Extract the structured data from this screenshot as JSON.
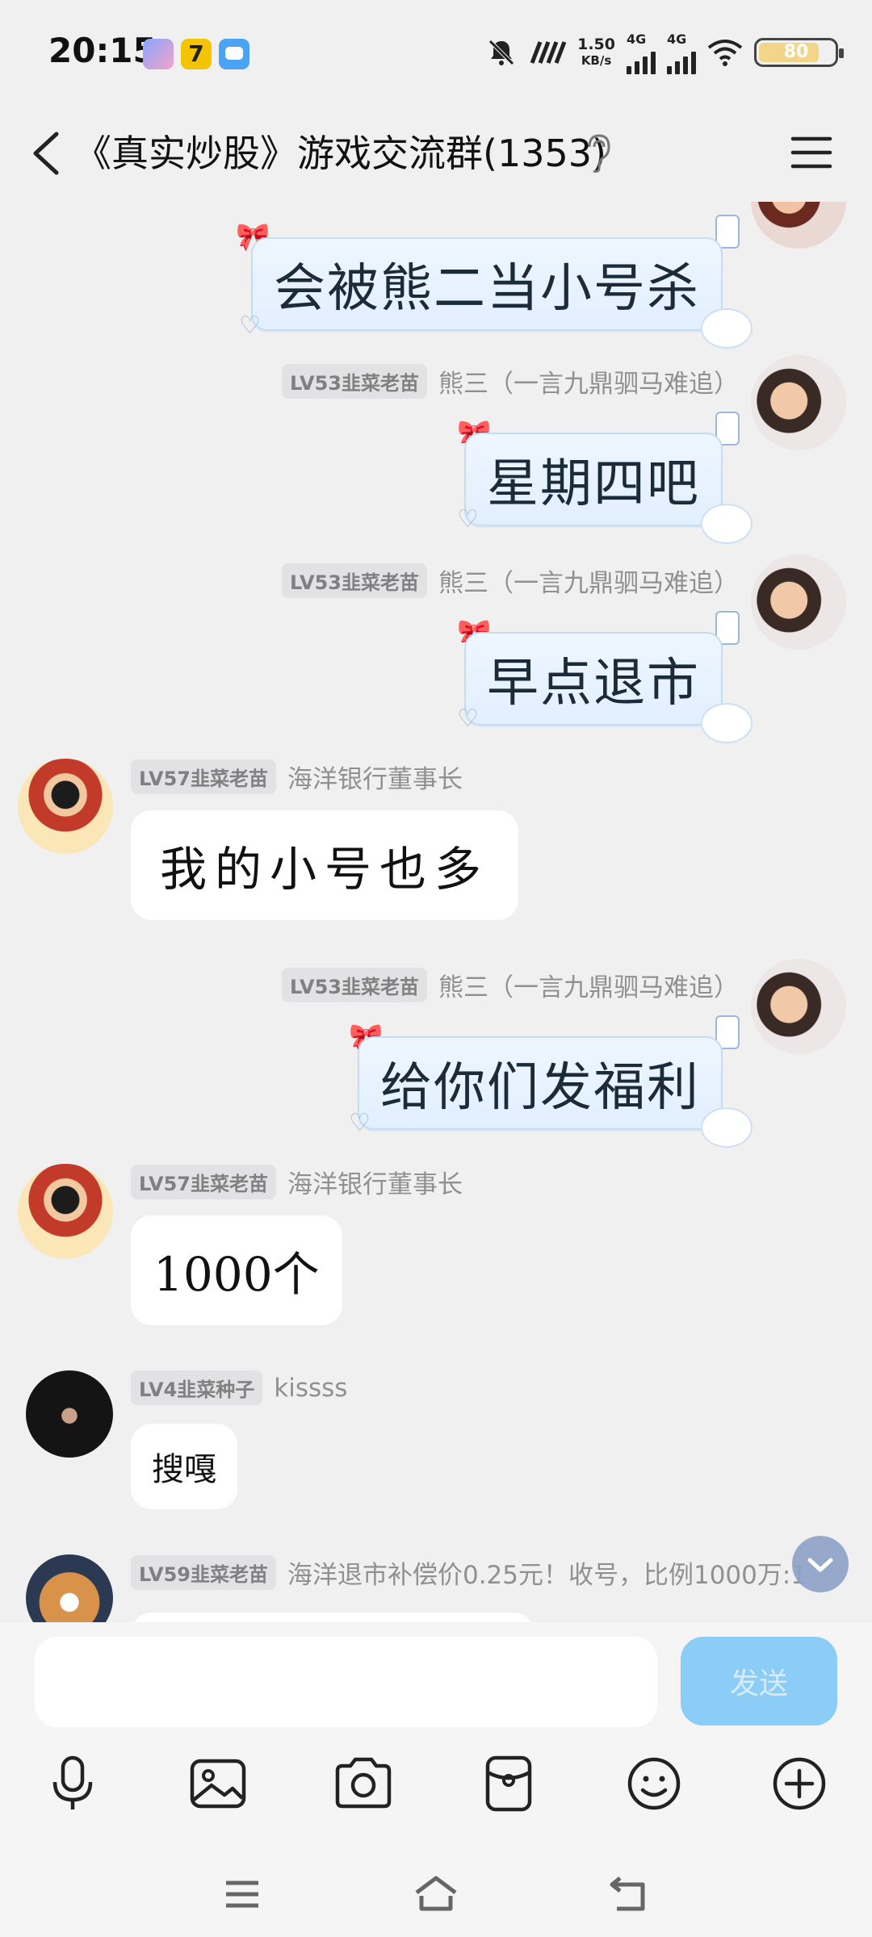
{
  "status_bar": {
    "time": "20:15",
    "net_speed_value": "1.50",
    "net_speed_unit": "KB/s",
    "signal_1_label": "4G",
    "signal_2_label": "4G",
    "battery_level": "80",
    "icons": [
      "app-icon-anime",
      "app-icon-7",
      "app-icon-chat",
      "mute-bell-icon",
      "hd-icon",
      "wifi-icon",
      "battery-icon"
    ]
  },
  "header": {
    "title": "《真实炒股》游戏交流群(1353)",
    "back_icon": "chevron-left-icon",
    "ear_icon": "ear-icon",
    "menu_icon": "menu-icon"
  },
  "messages": [
    {
      "side": "right",
      "badge": "",
      "nick": "",
      "text": "会被熊二当小号杀",
      "style": "decorated"
    },
    {
      "side": "right",
      "badge": "LV53韭菜老苗",
      "nick": "熊三（一言九鼎驷马难追）",
      "text": "星期四吧",
      "style": "decorated"
    },
    {
      "side": "right",
      "badge": "LV53韭菜老苗",
      "nick": "熊三（一言九鼎驷马难追）",
      "text": "早点退市",
      "style": "decorated"
    },
    {
      "side": "left",
      "badge": "LV57韭菜老苗",
      "nick": "海洋银行董事长",
      "text": "我的小号也多",
      "style": "plain"
    },
    {
      "side": "right",
      "badge": "LV53韭菜老苗",
      "nick": "熊三（一言九鼎驷马难追）",
      "text": "给你们发福利",
      "style": "decorated"
    },
    {
      "side": "left",
      "badge": "LV57韭菜老苗",
      "nick": "海洋银行董事长",
      "text": "1000个",
      "style": "plain"
    },
    {
      "side": "left",
      "badge": "LV4韭菜种子",
      "nick": "kissss",
      "text": "搜嘎",
      "style": "plain"
    },
    {
      "side": "left",
      "badge": "LV59韭菜老苗",
      "nick": "海洋退市补偿价0.25元！收号，比例1000万:1",
      "text": "",
      "style": "plain"
    }
  ],
  "input": {
    "placeholder": "",
    "send_label": "发送"
  },
  "toolbar": [
    "microphone-icon",
    "image-icon",
    "camera-icon",
    "red-packet-icon",
    "emoji-icon",
    "plus-icon"
  ],
  "nav": [
    "menu-nav-icon",
    "home-icon",
    "back-nav-icon"
  ],
  "colors": {
    "background": "#f0f0f0",
    "send_button": "#8ccdf7",
    "special_bubble": "#e2efff",
    "badge_bg": "#e2e2e4"
  }
}
